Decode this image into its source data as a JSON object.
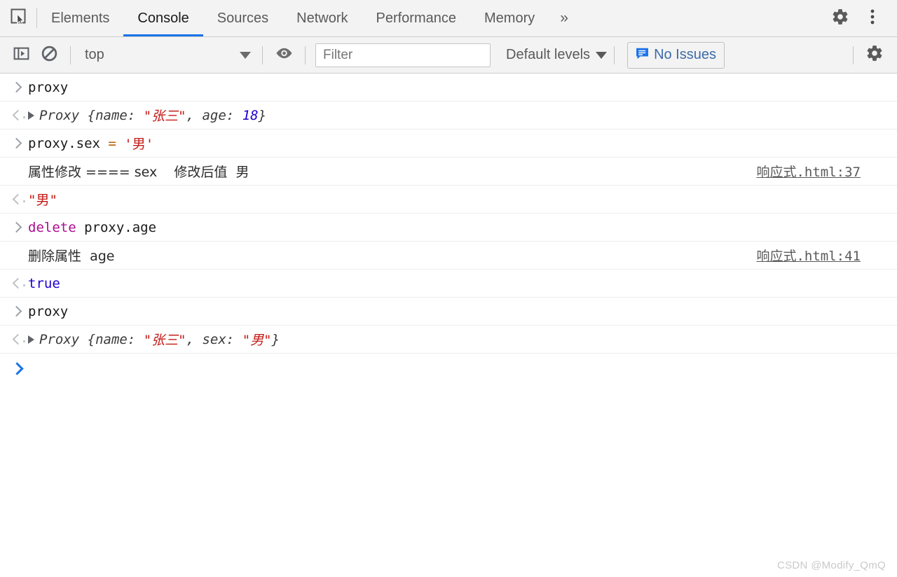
{
  "tabbar": {
    "inspect_icon": "inspect-element-icon",
    "tabs": [
      {
        "label": "Elements",
        "active": false
      },
      {
        "label": "Console",
        "active": true
      },
      {
        "label": "Sources",
        "active": false
      },
      {
        "label": "Network",
        "active": false
      },
      {
        "label": "Performance",
        "active": false
      },
      {
        "label": "Memory",
        "active": false
      }
    ],
    "more_label": "»",
    "settings_icon": "gear-icon",
    "more_options_icon": "kebab-menu-icon"
  },
  "toolbar": {
    "sidebar_toggle_icon": "console-sidebar-icon",
    "clear_icon": "clear-console-icon",
    "context": "top",
    "context_caret_icon": "chevron-down-icon",
    "eye_icon": "live-expression-eye-icon",
    "filter_placeholder": "Filter",
    "filter_value": "",
    "levels_label": "Default levels",
    "levels_caret_icon": "chevron-down-icon",
    "issues_icon": "issues-message-icon",
    "issues_label": "No Issues",
    "settings_icon": "gear-icon"
  },
  "console": {
    "rows": [
      {
        "kind": "input",
        "marker": "in",
        "tokens": [
          {
            "t": "proxy",
            "c": "plain"
          }
        ]
      },
      {
        "kind": "result",
        "marker": "out",
        "italic": true,
        "disclosure": true,
        "tokens": [
          {
            "t": "Proxy ",
            "c": "dim"
          },
          {
            "t": "{name: ",
            "c": "dim"
          },
          {
            "t": "\"张三\"",
            "c": "str"
          },
          {
            "t": ", age: ",
            "c": "dim"
          },
          {
            "t": "18",
            "c": "num"
          },
          {
            "t": "}",
            "c": "dim"
          }
        ]
      },
      {
        "kind": "input",
        "marker": "in",
        "tokens": [
          {
            "t": "proxy.sex ",
            "c": "plain"
          },
          {
            "t": "= ",
            "c": "op"
          },
          {
            "t": "'男'",
            "c": "str"
          }
        ]
      },
      {
        "kind": "log",
        "marker": "none",
        "chinese": true,
        "text": "属性修改 ==== sex    修改后值  男",
        "source": "响应式.html:37"
      },
      {
        "kind": "result",
        "marker": "out",
        "tokens": [
          {
            "t": "\"男\"",
            "c": "str"
          }
        ]
      },
      {
        "kind": "input",
        "marker": "in",
        "tokens": [
          {
            "t": "delete",
            "c": "kw"
          },
          {
            "t": " proxy.age",
            "c": "plain"
          }
        ]
      },
      {
        "kind": "log",
        "marker": "none",
        "chinese": true,
        "text": "删除属性  age",
        "source": "响应式.html:41"
      },
      {
        "kind": "result",
        "marker": "out",
        "tokens": [
          {
            "t": "true",
            "c": "bool"
          }
        ]
      },
      {
        "kind": "input",
        "marker": "in",
        "tokens": [
          {
            "t": "proxy",
            "c": "plain"
          }
        ]
      },
      {
        "kind": "result",
        "marker": "out",
        "italic": true,
        "disclosure": true,
        "tokens": [
          {
            "t": "Proxy ",
            "c": "dim"
          },
          {
            "t": "{name: ",
            "c": "dim"
          },
          {
            "t": "\"张三\"",
            "c": "str"
          },
          {
            "t": ", sex: ",
            "c": "dim"
          },
          {
            "t": "\"男\"",
            "c": "str"
          },
          {
            "t": "}",
            "c": "dim"
          }
        ]
      },
      {
        "kind": "prompt",
        "marker": "prompt",
        "tokens": []
      }
    ]
  },
  "watermark": "CSDN @Modify_QmQ",
  "colors": {
    "accent": "#1a73e8",
    "toolbar_bg": "#f3f3f3",
    "string": "#c41a16",
    "number": "#1c00cf",
    "keyword": "#aa0d91",
    "operator": "#b85c00",
    "issues_text": "#3c6ba8"
  }
}
